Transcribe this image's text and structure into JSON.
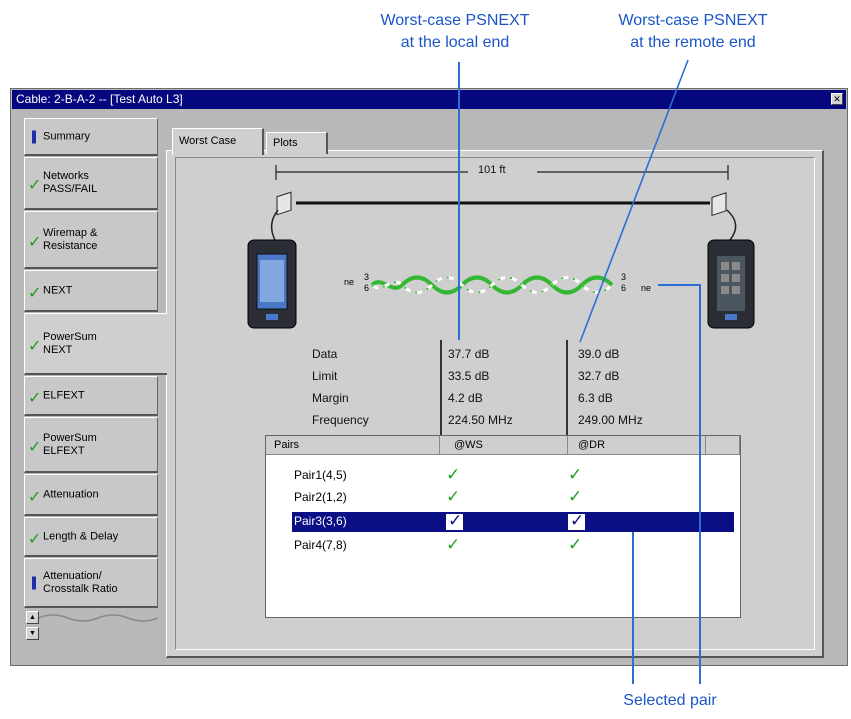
{
  "annotations": {
    "local_end": [
      "Worst-case PSNEXT",
      "at the local end"
    ],
    "remote_end": [
      "Worst-case PSNEXT",
      "at the remote end"
    ],
    "selected_pair": "Selected pair"
  },
  "window": {
    "title": "Cable: 2-B-A-2 -- [Test Auto L3]"
  },
  "sidebar": {
    "items": [
      {
        "label": "Summary",
        "status": "info"
      },
      {
        "label": "Networks\nPASS/FAIL",
        "status": "pass"
      },
      {
        "label": "Wiremap &\nResistance",
        "status": "pass"
      },
      {
        "label": "NEXT",
        "status": "pass"
      },
      {
        "label": "PowerSum\nNEXT",
        "status": "pass",
        "selected": true
      },
      {
        "label": "ELFEXT",
        "status": "pass"
      },
      {
        "label": "PowerSum\nELFEXT",
        "status": "pass"
      },
      {
        "label": "Attenuation",
        "status": "pass"
      },
      {
        "label": "Length & Delay",
        "status": "pass"
      },
      {
        "label": "Attenuation/\nCrosstalk Ratio",
        "status": "info"
      }
    ]
  },
  "tabs": [
    {
      "label": "Worst Case",
      "active": true
    },
    {
      "label": "Plots"
    }
  ],
  "diagram": {
    "length": "101 ft",
    "pair_left_top": "3",
    "pair_left_bottom": "6",
    "pair_right_top": "3",
    "pair_right_bottom": "6",
    "end_left": "ne",
    "end_right": "ne"
  },
  "measurements": {
    "labels": [
      "Data",
      "Limit",
      "Margin",
      "Frequency"
    ],
    "local": [
      "37.7 dB",
      "33.5 dB",
      "4.2 dB",
      "224.50 MHz"
    ],
    "remote": [
      "39.0 dB",
      "32.7 dB",
      "6.3 dB",
      "249.00 MHz"
    ]
  },
  "pairs_table": {
    "columns": [
      "Pairs",
      "@WS",
      "@DR"
    ],
    "rows": [
      {
        "name": "Pair1(4,5)",
        "ws": true,
        "dr": true
      },
      {
        "name": "Pair2(1,2)",
        "ws": true,
        "dr": true
      },
      {
        "name": "Pair3(3,6)",
        "ws": true,
        "dr": true,
        "selected": true
      },
      {
        "name": "Pair4(7,8)",
        "ws": true,
        "dr": true
      }
    ]
  },
  "colors": {
    "title_bar": "#05077e",
    "selection": "#0a0f86",
    "check": "#23a023",
    "callout": "#1a56c8"
  }
}
